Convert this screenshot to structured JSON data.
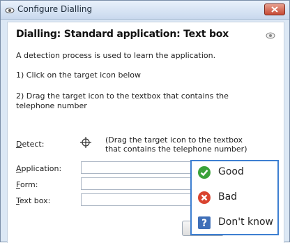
{
  "window": {
    "title": "Configure Dialling",
    "close_icon": "close-icon",
    "app_icon": "eye-icon"
  },
  "heading": "Dialling: Standard application: Text box",
  "intro": "A detection process is used to learn the application.",
  "step1": "1) Click on the target icon below",
  "step2": "2) Drag the target icon to the textbox that contains the telephone number",
  "detect": {
    "label_access": "D",
    "label_rest": "etect:",
    "icon": "crosshair-icon",
    "note": "(Drag the target icon to the textbox that contains the telephone number)"
  },
  "fields": [
    {
      "access": "A",
      "rest": "pplication:"
    },
    {
      "access": "F",
      "rest": "orm:"
    },
    {
      "access": "T",
      "rest": "ext box:"
    }
  ],
  "feedback": {
    "items": [
      {
        "label": "Good",
        "icon": "check-circle-icon",
        "color": "#3aa23a"
      },
      {
        "label": "Bad",
        "icon": "x-circle-icon",
        "color": "#d9432f"
      },
      {
        "label": "Don't know",
        "icon": "question-icon",
        "color": "#3f6fb8"
      }
    ],
    "border_color": "#3d7fd1"
  }
}
